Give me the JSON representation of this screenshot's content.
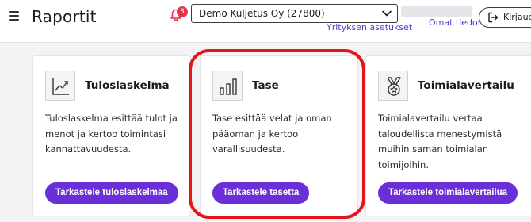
{
  "header": {
    "title": "Raportit",
    "notification_count": "3",
    "company_select": {
      "value": "Demo Kuljetus Oy (27800)"
    },
    "company_settings_label": "Yrityksen asetukset",
    "my_info_label": "Omat tiedot",
    "logout_label": "Kirjaudu"
  },
  "cards": [
    {
      "title": "Tuloslaskelma",
      "description": "Tuloslaskelma esittää tulot ja menot ja kertoo toimintasi kannattavuudesta.",
      "button": "Tarkastele tuloslaskelmaa",
      "icon": "line-chart-icon"
    },
    {
      "title": "Tase",
      "description": "Tase esittää velat ja oman pääoman ja kertoo varallisuudesta.",
      "button": "Tarkastele tasetta",
      "icon": "bar-chart-icon"
    },
    {
      "title": "Toimialavertailu",
      "description": "Toimialavertailu vertaa taloudellista menestymistä muihin saman toimialan toimijoihin.",
      "button": "Tarkastele toimialavertailua",
      "icon": "medal-icon"
    }
  ],
  "colors": {
    "accent": "#6a2fd6",
    "link": "#5b35c9",
    "badge": "#e0354f",
    "highlight": "#e3151a"
  }
}
